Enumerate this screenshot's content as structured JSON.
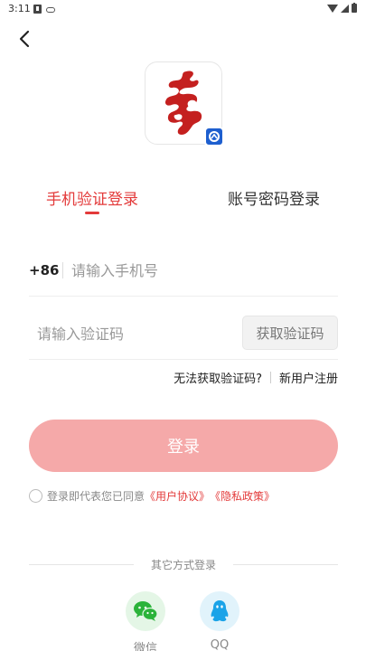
{
  "status_bar": {
    "time": "3:11"
  },
  "icons": {
    "back": "back-arrow-icon",
    "logo": "app-logo-icon",
    "wechat": "wechat-icon",
    "qq": "qq-icon"
  },
  "colors": {
    "accent": "#e33a3a",
    "login_button": "#f5a9a9",
    "wechat": "#2bb33a",
    "qq": "#1aa3e8"
  },
  "tabs": {
    "phone_login": "手机验证登录",
    "account_login": "账号密码登录"
  },
  "form": {
    "country_code": "+86",
    "phone_placeholder": "请输入手机号",
    "code_placeholder": "请输入验证码",
    "get_code_label": "获取验证码"
  },
  "help": {
    "no_code": "无法获取验证码?",
    "register": "新用户注册"
  },
  "login_label": "登录",
  "agreement": {
    "prefix": "登录即代表您已同意",
    "user_agreement": "《用户协议》",
    "privacy_policy": "《隐私政策》"
  },
  "other_login": {
    "title": "其它方式登录",
    "wechat": "微信",
    "qq": "QQ"
  }
}
